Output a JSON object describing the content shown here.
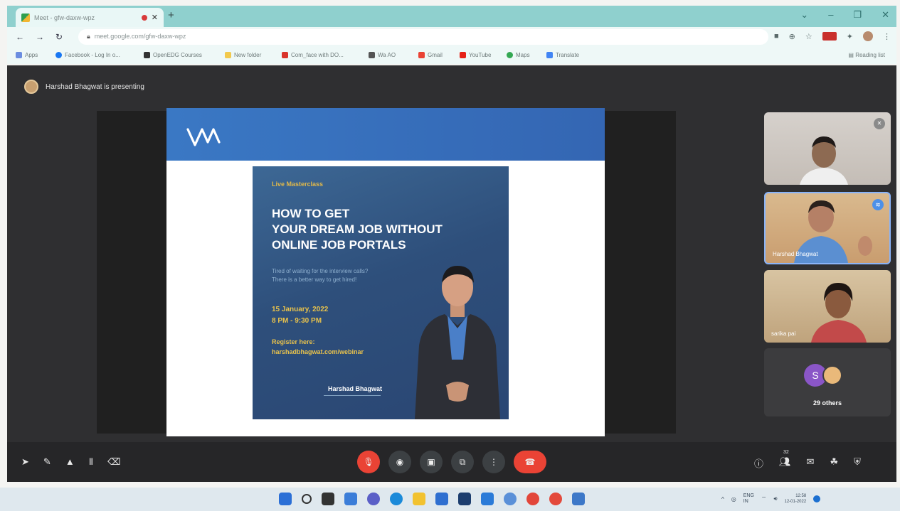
{
  "browser": {
    "tab_title": "Meet - gfw-daxw-wpz",
    "url": "meet.google.com/gfw-daxw-wpz",
    "bookmarks": [
      "Apps",
      "Facebook - Log In o...",
      "OpenEDG Courses",
      "New folder",
      "Com_face with DO...",
      "Wa AO",
      "Gmail",
      "YouTube",
      "Maps",
      "Translate"
    ],
    "reading_list": "Reading list",
    "colors": {
      "tabbar": "#8fd0ce",
      "toolbar": "#eef8f7"
    }
  },
  "meet": {
    "presenting_text": "Harshad Bhagwat is presenting",
    "participants": [
      {
        "name": "",
        "muted": true
      },
      {
        "name": "Harshad Bhagwat",
        "speaking": true
      },
      {
        "name": "sarika pai"
      }
    ],
    "others_initial": "S",
    "others_label": "29 others",
    "people_count": "32",
    "controls": {
      "annotation_icons": [
        "pointer-icon",
        "pen-icon",
        "highlighter-icon",
        "text-icon",
        "eraser-icon"
      ],
      "center_icons": [
        "mic-off-icon",
        "camera-icon",
        "captions-icon",
        "present-icon",
        "more-icon",
        "hangup-icon"
      ],
      "right_icons": [
        "info-icon",
        "people-icon",
        "chat-icon",
        "activities-icon",
        "host-controls-icon"
      ]
    },
    "colors": {
      "background": "#2f2f31",
      "accent_red": "#ea4335",
      "speaking_blue": "#4d90e8"
    }
  },
  "slide": {
    "logo_text": "vm",
    "poster": {
      "tag": "Live Masterclass",
      "headline": [
        "HOW TO GET",
        "YOUR DREAM JOB WITHOUT",
        "ONLINE JOB PORTALS"
      ],
      "subtext": [
        "Tired of waiting for the interview calls?",
        "There is a better way to get hired!"
      ],
      "date": "15 January, 2022",
      "time": "8 PM - 9:30 PM",
      "register_label": "Register here:",
      "register_url": "harshadbhagwat.com/webinar",
      "presenter": "Harshad Bhagwat"
    }
  },
  "taskbar": {
    "tray_lang": "ENG",
    "tray_region": "IN",
    "time": "12:58",
    "date": "12-01-2022"
  }
}
